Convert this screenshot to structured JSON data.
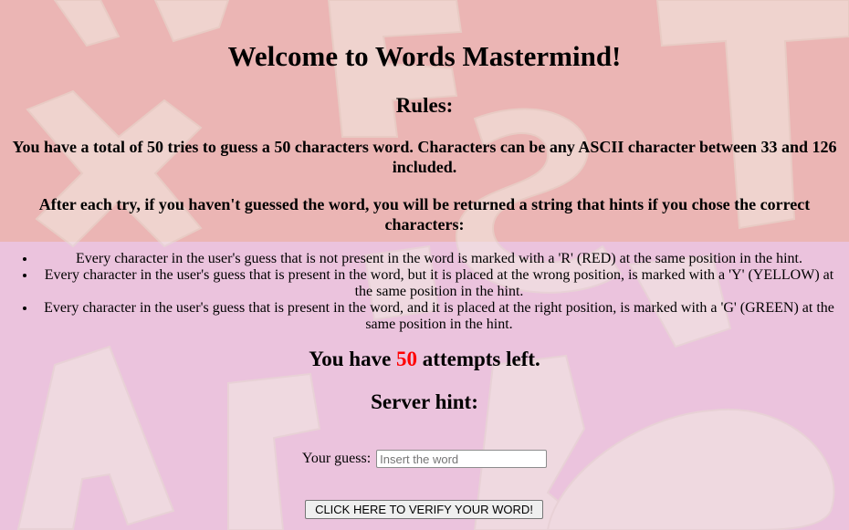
{
  "page": {
    "title": "Welcome to Words Mastermind!",
    "rules_heading": "Rules:",
    "rule_paragraph_1": "You have a total of 50 tries to guess a 50 characters word. Characters can be any ASCII character between 33 and 126 included.",
    "rule_paragraph_2": "After each try, if you haven't guessed the word, you will be returned a string that hints if you chose the correct characters:",
    "hint_rules": [
      "Every character in the user's guess that is not present in the word is marked with a 'R' (RED) at the same position in the hint.",
      "Every character in the user's guess that is present in the word, but it is placed at the wrong position, is marked with a 'Y' (YELLOW) at the same position in the hint.",
      "Every character in the user's guess that is present in the word, and it is placed at the right position, is marked with a 'G' (GREEN) at the same position in the hint."
    ],
    "attempts_prefix": "You have",
    "attempts_count": "50",
    "attempts_suffix": "attempts left.",
    "server_hint_label": "Server hint:",
    "server_hint_value": ""
  },
  "form": {
    "guess_label": "Your guess:",
    "guess_value": "",
    "guess_placeholder": "Insert the word",
    "verify_button_label": "CLICK HERE TO VERIFY YOUR WORD!"
  },
  "colors": {
    "attempts_count": "#ff0000",
    "background_top": "#ebb5b4",
    "background_bottom": "#ebc3dd",
    "wooden_letters": "#f3ece4"
  }
}
